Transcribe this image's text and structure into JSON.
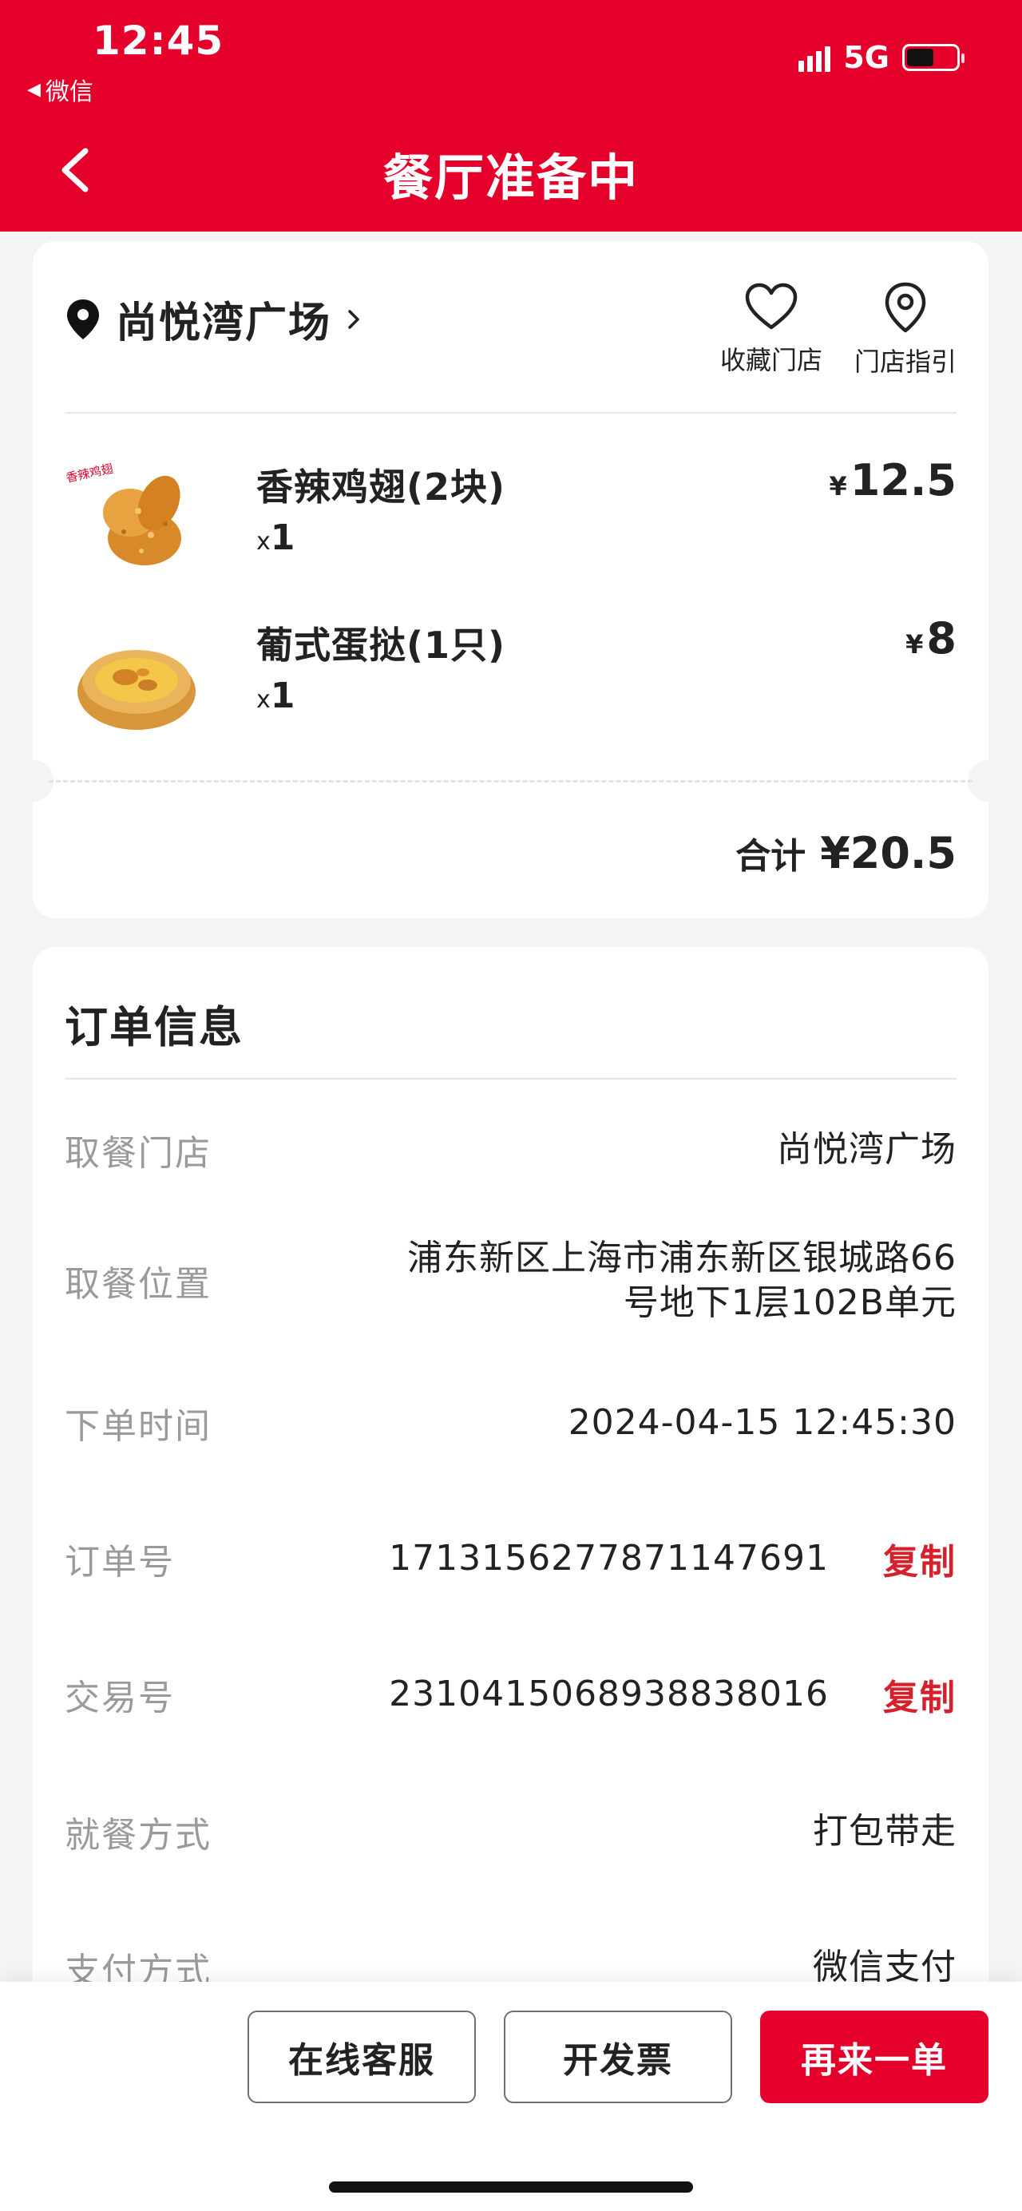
{
  "status_bar": {
    "time": "12:45",
    "back_app": "微信",
    "network": "5G",
    "battery_level": 0.55
  },
  "header": {
    "title": "餐厅准备中"
  },
  "store": {
    "name": "尚悦湾广场",
    "actions": [
      {
        "label": "收藏门店",
        "icon": "heart-icon"
      },
      {
        "label": "门店指引",
        "icon": "location-pin-icon"
      }
    ]
  },
  "products": [
    {
      "name": "香辣鸡翅(2块)",
      "qty_prefix": "x",
      "qty": "1",
      "currency": "¥",
      "price": "12.5"
    },
    {
      "name": "葡式蛋挞(1只)",
      "qty_prefix": "x",
      "qty": "1",
      "currency": "¥",
      "price": "8"
    }
  ],
  "total": {
    "label": "合计",
    "amount": "¥20.5"
  },
  "order_info": {
    "title": "订单信息",
    "rows": [
      {
        "label": "取餐门店",
        "value": "尚悦湾广场"
      },
      {
        "label": "取餐位置",
        "value_line1": "浦东新区上海市浦东新区银城路66",
        "value_line2": "号地下1层102B单元"
      },
      {
        "label": "下单时间",
        "value": "2024-04-15 12:45:30"
      },
      {
        "label": "订单号",
        "value": "1713156277871147691",
        "action": "复制"
      },
      {
        "label": "交易号",
        "value": "2310415068938838016",
        "action": "复制"
      },
      {
        "label": "就餐方式",
        "value": "打包带走"
      },
      {
        "label": "支付方式",
        "value": "微信支付"
      }
    ]
  },
  "bottom_actions": {
    "customer_service": "在线客服",
    "invoice": "开发票",
    "reorder": "再来一单"
  },
  "colors": {
    "brand_red": "#e4002b",
    "copy_red": "#d6202c",
    "muted_label": "#9a9a9a"
  }
}
